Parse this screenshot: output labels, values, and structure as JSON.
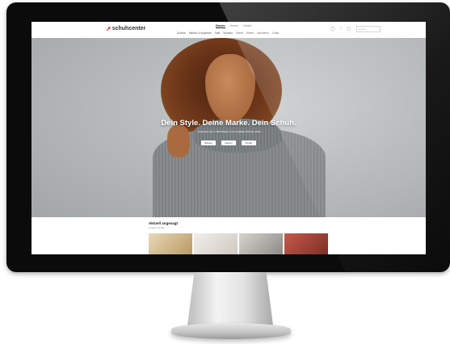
{
  "site": {
    "logo_text": "schuhcenter",
    "util_nav": [
      "Damen",
      "Herren",
      "Kinder"
    ],
    "main_nav": [
      "Schuhe",
      "Marken & Angebote",
      "Sale",
      "Sneaker",
      "Stiefel",
      "Winter",
      "Neuheiten",
      "Outlet"
    ],
    "search_placeholder": "Suche"
  },
  "hero": {
    "headline": "Dein Style. Deine Marke. Dein Schuh.",
    "subtext": "Entdecke über 1.000 Marken und unzählige Schuhe online",
    "buttons": [
      "Damen",
      "Herren",
      "Kinder"
    ]
  },
  "section": {
    "title": "Aktuell angesagt",
    "subtitle": "Unsere Trends"
  },
  "colors": {
    "brand": "#d71920",
    "bezel": "#0b0b0c"
  }
}
